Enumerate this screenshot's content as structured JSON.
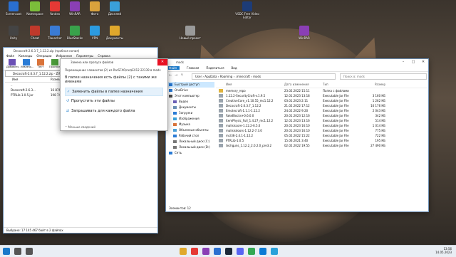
{
  "desktop": {
    "icons": [
      {
        "label": "Screencast",
        "color": "#2a6fd0"
      },
      {
        "label": "Namespace",
        "color": "#7bbd3a"
      },
      {
        "label": "Yandex",
        "color": "#e53935"
      },
      {
        "label": "WinRAR",
        "color": "#8a3fb5"
      },
      {
        "label": "Фото",
        "color": "#d9a23c"
      },
      {
        "label": "Дисплей",
        "color": "#3aa0d9"
      },
      {
        "label": "VSDC Free Video Editor",
        "color": "#1d3c77"
      },
      {
        "label": "Unity",
        "color": "#444444"
      },
      {
        "label": "Cheat",
        "color": "#c0392b"
      },
      {
        "label": "Tlauncher",
        "color": "#3a7bd5"
      },
      {
        "label": "BlueStacks",
        "color": "#39a24b"
      },
      {
        "label": "VPN",
        "color": "#2c9be0"
      },
      {
        "label": "Документы",
        "color": "#e0a82c"
      },
      {
        "label": "Новый проект",
        "color": "#9a9a9a"
      },
      {
        "label": "WinRAR",
        "color": "#8a3fb5"
      }
    ]
  },
  "winrar": {
    "title": "Decocraft-2.6.3.7_1.12.2.zip (пробная копия)",
    "menu": [
      "Файл",
      "Команды",
      "Операции",
      "Избранное",
      "Параметры",
      "Справка"
    ],
    "tools": [
      "Добавить",
      "Извлечь...",
      "Тест",
      "Просмотр"
    ],
    "path": "Decocraft-2.6.3.7_1.12.2.zip - ZIP архив",
    "cols": [
      "Имя",
      "Размер",
      "Сжат"
    ],
    "rows": [
      {
        "name": "..",
        "size": "",
        "packed": ""
      },
      {
        "name": "Decocraft-2.6.3...",
        "size": "16 876 718",
        "packed": "16 876 718"
      },
      {
        "name": "PTRLib-1.0.5.jar",
        "size": "198 749",
        "packed": "198 749"
      }
    ],
    "status": "Выбрано: 17 145 467 байт в 2 файлах"
  },
  "dialog": {
    "title": "Замена или пропуск файлов",
    "subtitle": "Перемещение элементов (2) из RarSFX0\\rar$EX12.22339 в mods",
    "message": "В папке назначения есть файлы (2) с такими же именами",
    "options": [
      "Заменить файлы в папке назначения",
      "Пропустить эти файлы",
      "Запрашивать для каждого файла"
    ],
    "more": "Меньше сведений"
  },
  "explorer": {
    "title": "mods",
    "ribbon_tabs": [
      "Файл",
      "Главная",
      "Поделиться",
      "Вид"
    ],
    "breadcrumb": "User  ›  AppData  ›  Roaming  ›  .minecraft  ›  mods",
    "search_placeholder": "Поиск в: mods",
    "sidebar": [
      {
        "label": "Быстрый доступ",
        "color": "#2a7bd5"
      },
      {
        "label": "OneDrive",
        "color": "#2a7bd5"
      },
      {
        "label": "Этот компьютер",
        "color": "#4a4a4a"
      },
      {
        "label": "Видео",
        "color": "#6b5fb5"
      },
      {
        "label": "Документы",
        "color": "#6b8fb5"
      },
      {
        "label": "Загрузки",
        "color": "#2a7bd5"
      },
      {
        "label": "Изображения",
        "color": "#3aa0d9"
      },
      {
        "label": "Музыка",
        "color": "#d9733a"
      },
      {
        "label": "Объемные объекты",
        "color": "#4aa0d9"
      },
      {
        "label": "Рабочий стол",
        "color": "#2a7bd5"
      },
      {
        "label": "Локальный диск (C:)",
        "color": "#777777"
      },
      {
        "label": "Локальный диск (D:)",
        "color": "#777777"
      },
      {
        "label": "Сеть",
        "color": "#2a7bd5"
      }
    ],
    "columns": [
      "Имя",
      "Дата изменения",
      "Тип",
      "Размер"
    ],
    "files": [
      {
        "name": "memory_repo",
        "date": "23.02.2022 15:11",
        "type": "Папка с файлами",
        "size": ""
      },
      {
        "name": "1.12.2-SecurityCraft-v.1.9.5",
        "date": "12.01.2023 13:18",
        "type": "Executable Jar File",
        "size": "3 160 КБ"
      },
      {
        "name": "CreativeCore_v1.10.55_mc1.12.2",
        "date": "03.01.2023 2:11",
        "type": "Executable Jar File",
        "size": "1 262 КБ"
      },
      {
        "name": "Decocraft-2.6.3.7_1.12.2",
        "date": "21.02.2022 17:12",
        "type": "Executable Jar File",
        "size": "16 176 КБ"
      },
      {
        "name": "Emotecraft-1.1.1-1.12.2",
        "date": "24.02.2022 9:20",
        "type": "Executable Jar File",
        "size": "2 043 КБ"
      },
      {
        "name": "FakeBlocks+0.6.0.0",
        "date": "20.01.2023 12:16",
        "type": "Executable Jar File",
        "size": "342 КБ"
      },
      {
        "name": "ItemPhysic_Full_1.4.27_mc1.12.2",
        "date": "12.01.2023 13:16",
        "type": "Executable Jar File",
        "size": "514 КБ"
      },
      {
        "name": "malisiscore-1.12.2-6.5.0",
        "date": "20.01.2023 16:10",
        "type": "Executable Jar File",
        "size": "1 014 КБ"
      },
      {
        "name": "malisisdoors-1.12.2-7.3.0",
        "date": "20.01.2023 16:10",
        "type": "Executable Jar File",
        "size": "775 КБ"
      },
      {
        "name": "mcl36-2.4.1-1.12.2",
        "date": "05.02.2022 15:22",
        "type": "Executable Jar File",
        "size": "722 КБ"
      },
      {
        "name": "PTRLib-1.0.5",
        "date": "15.06.2021 3:40",
        "type": "Executable Jar File",
        "size": "195 КБ"
      },
      {
        "name": "techguns_1.12.2_2.0.2.0_pre3.2",
        "date": "02.02.2022 19:55",
        "type": "Executable Jar File",
        "size": "27 490 КБ"
      }
    ],
    "status": "Элементов: 12"
  },
  "taskbar": {
    "apps": [
      {
        "name": "start",
        "color": "#1979ca"
      },
      {
        "name": "search",
        "color": "#555555"
      },
      {
        "name": "taskview",
        "color": "#555555"
      },
      {
        "name": "explorer",
        "color": "#e0a82c"
      },
      {
        "name": "yandex",
        "color": "#e53935"
      },
      {
        "name": "winrar",
        "color": "#8a3fb5"
      },
      {
        "name": "media",
        "color": "#2a6fd0"
      },
      {
        "name": "steam",
        "color": "#1b2838"
      },
      {
        "name": "discord",
        "color": "#5865f2"
      },
      {
        "name": "chrome",
        "color": "#34a853"
      },
      {
        "name": "edge",
        "color": "#0c7ad4"
      },
      {
        "name": "telegram",
        "color": "#2aa1da"
      }
    ],
    "time": "13:56",
    "date": "14.05.2023"
  }
}
